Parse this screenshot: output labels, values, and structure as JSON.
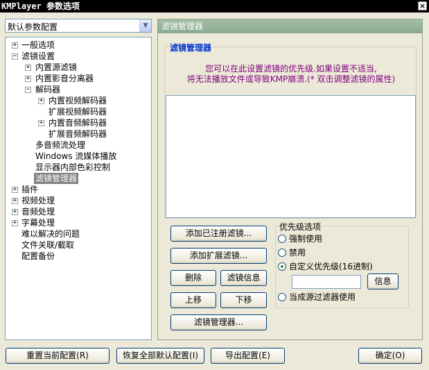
{
  "window": {
    "title": "KMPlayer 参数选项",
    "close": "×"
  },
  "preset": {
    "value": "默认参数配置",
    "arrow": "▼"
  },
  "tree": [
    {
      "label": "一般选项",
      "exp": "+"
    },
    {
      "label": "滤镜设置",
      "exp": "−"
    },
    {
      "label": "内置源滤镜",
      "exp": "+"
    },
    {
      "label": "内置影音分离器",
      "exp": "+"
    },
    {
      "label": "解码器",
      "exp": "−"
    },
    {
      "label": "内置视频解码器",
      "exp": "+"
    },
    {
      "label": "扩展视频解码器"
    },
    {
      "label": "内置音频解码器",
      "exp": "+"
    },
    {
      "label": "扩展音频解码器"
    },
    {
      "label": "多音频流处理"
    },
    {
      "label": "Windows 流媒体播放"
    },
    {
      "label": "显示器内部色彩控制"
    },
    {
      "label": "滤镜管理器"
    },
    {
      "label": "插件",
      "exp": "+"
    },
    {
      "label": "视频处理",
      "exp": "+"
    },
    {
      "label": "音频处理",
      "exp": "+"
    },
    {
      "label": "字幕处理",
      "exp": "+"
    },
    {
      "label": "难以解决的问题"
    },
    {
      "label": "文件关联/截取"
    },
    {
      "label": "配置备份"
    }
  ],
  "panel": {
    "header": "滤镜管理器",
    "group_title": "滤镜管理器",
    "desc_line1": "您可以在此设置滤镜的优先级.如果设置不适当,",
    "desc_line2": "将无法播放文件或导致KMP崩溃.(* 双击调整滤镜的属性)"
  },
  "buttons": {
    "add_registered": "添加已注册滤镜...",
    "add_external": "添加扩展滤镜...",
    "delete": "删除",
    "filter_info": "滤镜信息",
    "move_up": "上移",
    "move_down": "下移",
    "filter_manager": "滤镜管理器..."
  },
  "priority": {
    "title": "优先级选项",
    "force": "强制使用",
    "disable": "禁用",
    "custom": "自定义优先级(16进制)",
    "info": "信息",
    "bypass": "当成源过滤器使用",
    "selected": "custom"
  },
  "footer": {
    "reset_current": "重置当前配置(R)",
    "restore_all": "恢复全部默认配置(I)",
    "export": "导出配置(E)",
    "ok": "确定(O)"
  }
}
